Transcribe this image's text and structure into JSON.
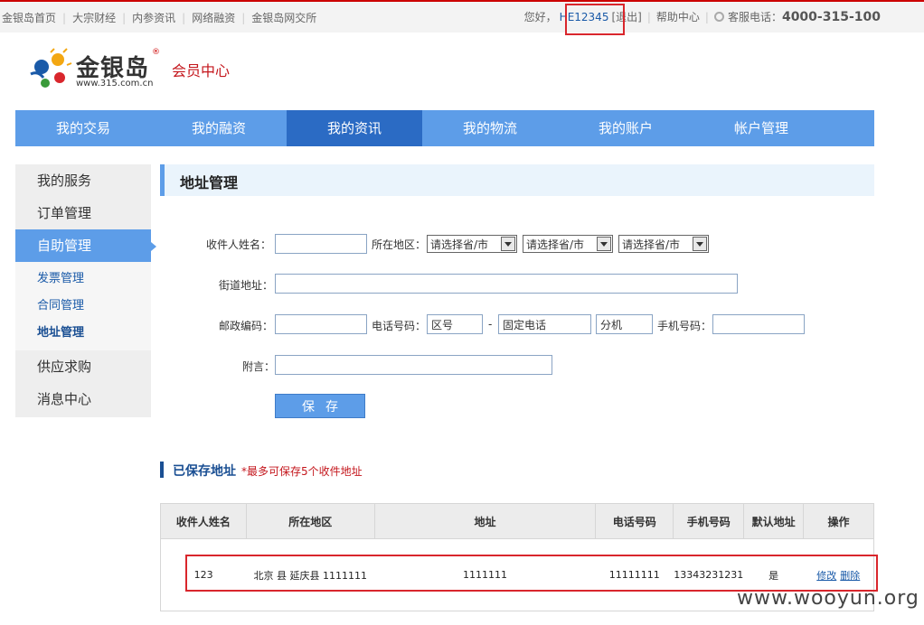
{
  "topbar": {
    "links": [
      "金银岛首页",
      "大宗财经",
      "内参资讯",
      "网络融资",
      "金银岛网交所"
    ],
    "greeting": "您好，",
    "username": "HE12345",
    "logout": "[退出]",
    "help": "帮助中心",
    "hotline_label": "客服电话：",
    "hotline": "4000-315-100"
  },
  "header": {
    "brand": "金银岛",
    "reg_mark": "®",
    "url": "www.315.com.cn",
    "section": "会员中心"
  },
  "nav": {
    "items": [
      "我的交易",
      "我的融资",
      "我的资讯",
      "我的物流",
      "我的账户",
      "帐户管理"
    ],
    "active": "我的资讯"
  },
  "sidebar": {
    "items": [
      "我的服务",
      "订单管理",
      "自助管理"
    ],
    "sub_items": [
      "发票管理",
      "合同管理",
      "地址管理"
    ],
    "items_after": [
      "供应求购",
      "消息中心"
    ]
  },
  "page": {
    "title": "地址管理"
  },
  "form": {
    "name_label": "收件人姓名：",
    "region_label": "所在地区：",
    "select1": "请选择省/市",
    "select2": "请选择省/市",
    "select3": "请选择省/市",
    "street_label": "街道地址：",
    "zip_label": "邮政编码：",
    "phone_label": "电话号码：",
    "area_code": "区号",
    "landline": "固定电话",
    "extension": "分机",
    "mobile_label": "手机号码：",
    "note_label": "附言：",
    "save": "保存"
  },
  "saved": {
    "title": "已保存地址",
    "note": "*最多可保存5个收件地址",
    "columns": [
      "收件人姓名",
      "所在地区",
      "地址",
      "电话号码",
      "手机号码",
      "默认地址",
      "操作"
    ],
    "row": {
      "name": "123",
      "region": "北京 县 延庆县 1111111",
      "address": "1111111",
      "phone": "11111111",
      "mobile": "13343231231",
      "default": "是",
      "edit": "修改",
      "delete": "删除"
    }
  },
  "watermark": "www.wooyun.org",
  "colors": {
    "nav_blue": "#5d9de8",
    "nav_active": "#2b6bc4",
    "highlight_red": "#d9262c",
    "brand_red": "#c4161c"
  }
}
